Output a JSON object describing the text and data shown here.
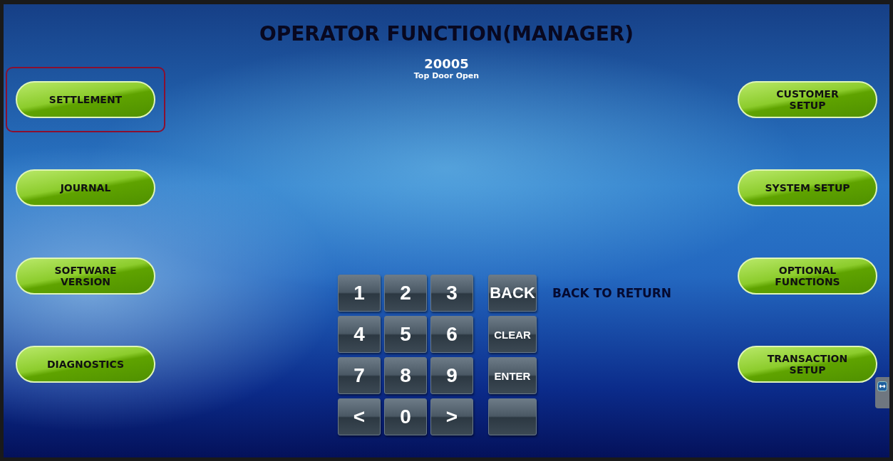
{
  "title": "OPERATOR FUNCTION(MANAGER)",
  "status": {
    "code": "20005",
    "message": "Top Door Open"
  },
  "left_buttons": [
    {
      "label": "SETTLEMENT",
      "highlighted": true
    },
    {
      "label": "JOURNAL",
      "highlighted": false
    },
    {
      "label": "SOFTWARE VERSION",
      "highlighted": false
    },
    {
      "label": "DIAGNOSTICS",
      "highlighted": false
    }
  ],
  "right_buttons": [
    {
      "label": "CUSTOMER SETUP",
      "highlighted": false
    },
    {
      "label": "SYSTEM SETUP",
      "highlighted": false
    },
    {
      "label": "OPTIONAL FUNCTIONS",
      "highlighted": false
    },
    {
      "label": "TRANSACTION SETUP",
      "highlighted": false
    }
  ],
  "keypad": [
    [
      {
        "kind": "digit",
        "label": "1"
      },
      {
        "kind": "digit",
        "label": "2"
      },
      {
        "kind": "digit",
        "label": "3"
      },
      {
        "kind": "large_function",
        "label": "BACK"
      }
    ],
    [
      {
        "kind": "digit",
        "label": "4"
      },
      {
        "kind": "digit",
        "label": "5"
      },
      {
        "kind": "digit",
        "label": "6"
      },
      {
        "kind": "function",
        "label": "CLEAR"
      }
    ],
    [
      {
        "kind": "digit",
        "label": "7"
      },
      {
        "kind": "digit",
        "label": "8"
      },
      {
        "kind": "digit",
        "label": "9"
      },
      {
        "kind": "function",
        "label": "ENTER"
      }
    ],
    [
      {
        "kind": "digit",
        "label": "<"
      },
      {
        "kind": "digit",
        "label": "0"
      },
      {
        "kind": "digit",
        "label": ">"
      },
      {
        "kind": "blank"
      }
    ]
  ],
  "hint": "BACK TO RETURN"
}
